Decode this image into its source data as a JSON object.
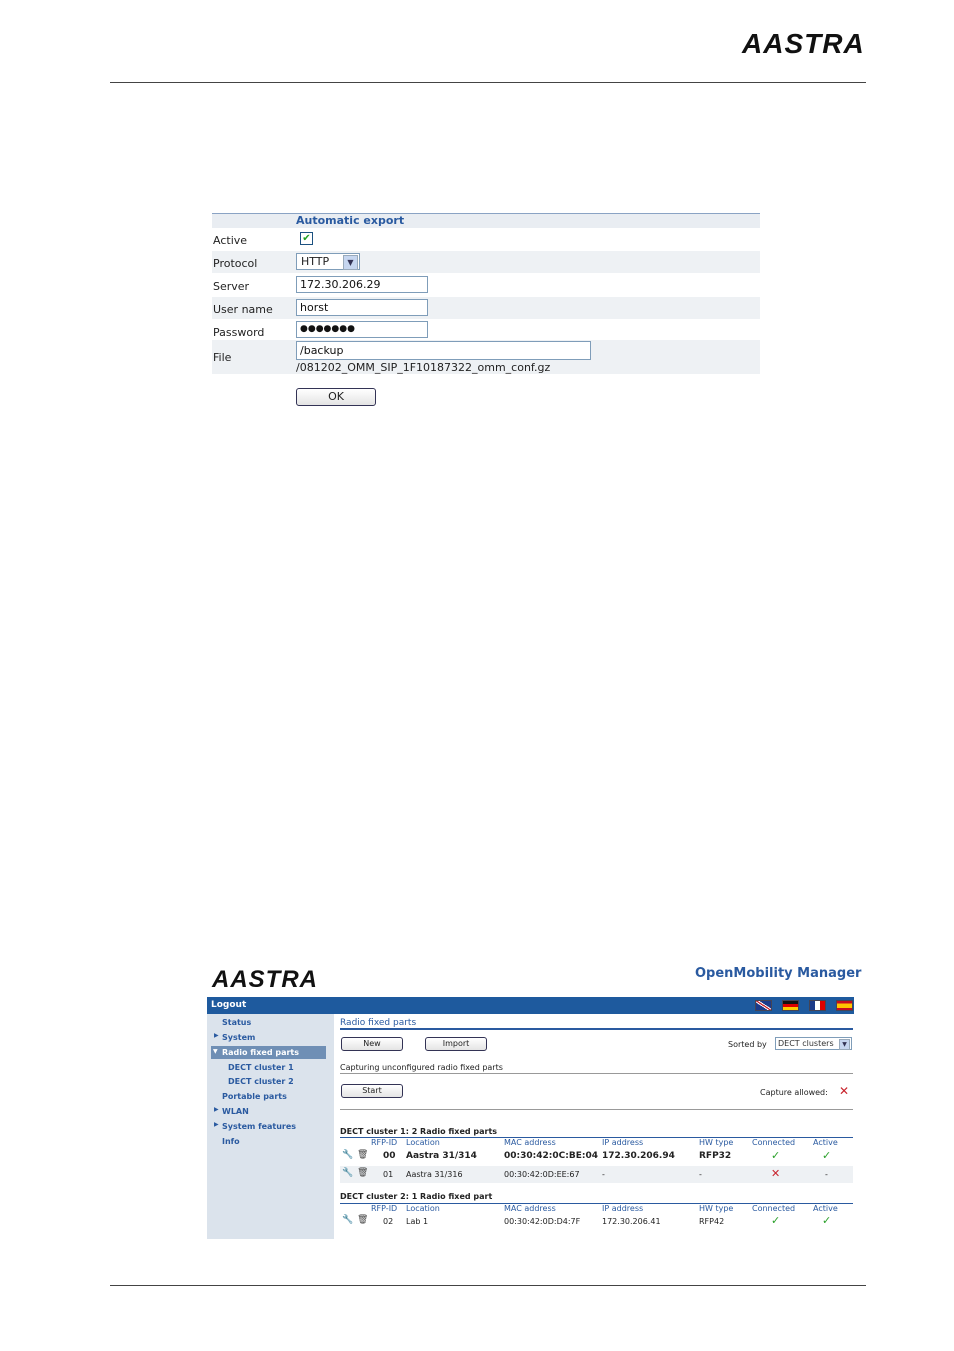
{
  "brand": {
    "logo_text": "AASTRA"
  },
  "auto_export": {
    "title": "Automatic export",
    "active_label": "Active",
    "active_checked": true,
    "protocol_label": "Protocol",
    "protocol_value": "HTTP",
    "server_label": "Server",
    "server_value": "172.30.206.29",
    "username_label": "User name",
    "username_value": "horst",
    "password_label": "Password",
    "password_value": "●●●●●●●",
    "file_label": "File",
    "file_value": "/backup",
    "file_hint": "/081202_OMM_SIP_1F10187322_omm_conf.gz",
    "ok_label": "OK"
  },
  "omm": {
    "logo_text": "AASTRA",
    "title": "OpenMobility Manager",
    "logout": "Logout",
    "nav": {
      "status": "Status",
      "system": "System",
      "radio_fixed_parts": "Radio fixed parts",
      "dect_cluster_1": "DECT cluster 1",
      "dect_cluster_2": "DECT cluster 2",
      "portable_parts": "Portable parts",
      "wlan": "WLAN",
      "system_features": "System features",
      "info": "Info"
    },
    "page_title": "Radio fixed parts",
    "new_label": "New",
    "import_label": "Import",
    "sorted_by_label": "Sorted by",
    "sorted_by_value": "DECT clusters",
    "capturing_label": "Capturing unconfigured radio fixed parts",
    "start_label": "Start",
    "capture_allowed_label": "Capture allowed:",
    "headers": {
      "rfp_id": "RFP-ID",
      "location": "Location",
      "mac": "MAC address",
      "ip": "IP address",
      "hw": "HW type",
      "connected": "Connected",
      "active": "Active"
    },
    "cluster1": {
      "title": "DECT cluster 1: 2 Radio fixed parts",
      "rows": [
        {
          "id": "00",
          "location": "Aastra 31/314",
          "mac": "00:30:42:0C:BE:04",
          "ip": "172.30.206.94",
          "hw": "RFP32",
          "connected": "✓",
          "active": "✓"
        },
        {
          "id": "01",
          "location": "Aastra 31/316",
          "mac": "00:30:42:0D:EE:67",
          "ip": "-",
          "hw": "-",
          "connected": "✕",
          "active": "-"
        }
      ]
    },
    "cluster2": {
      "title": "DECT cluster 2: 1 Radio fixed part",
      "rows": [
        {
          "id": "02",
          "location": "Lab 1",
          "mac": "00:30:42:0D:D4:7F",
          "ip": "172.30.206.41",
          "hw": "RFP42",
          "connected": "✓",
          "active": "✓"
        }
      ]
    }
  }
}
